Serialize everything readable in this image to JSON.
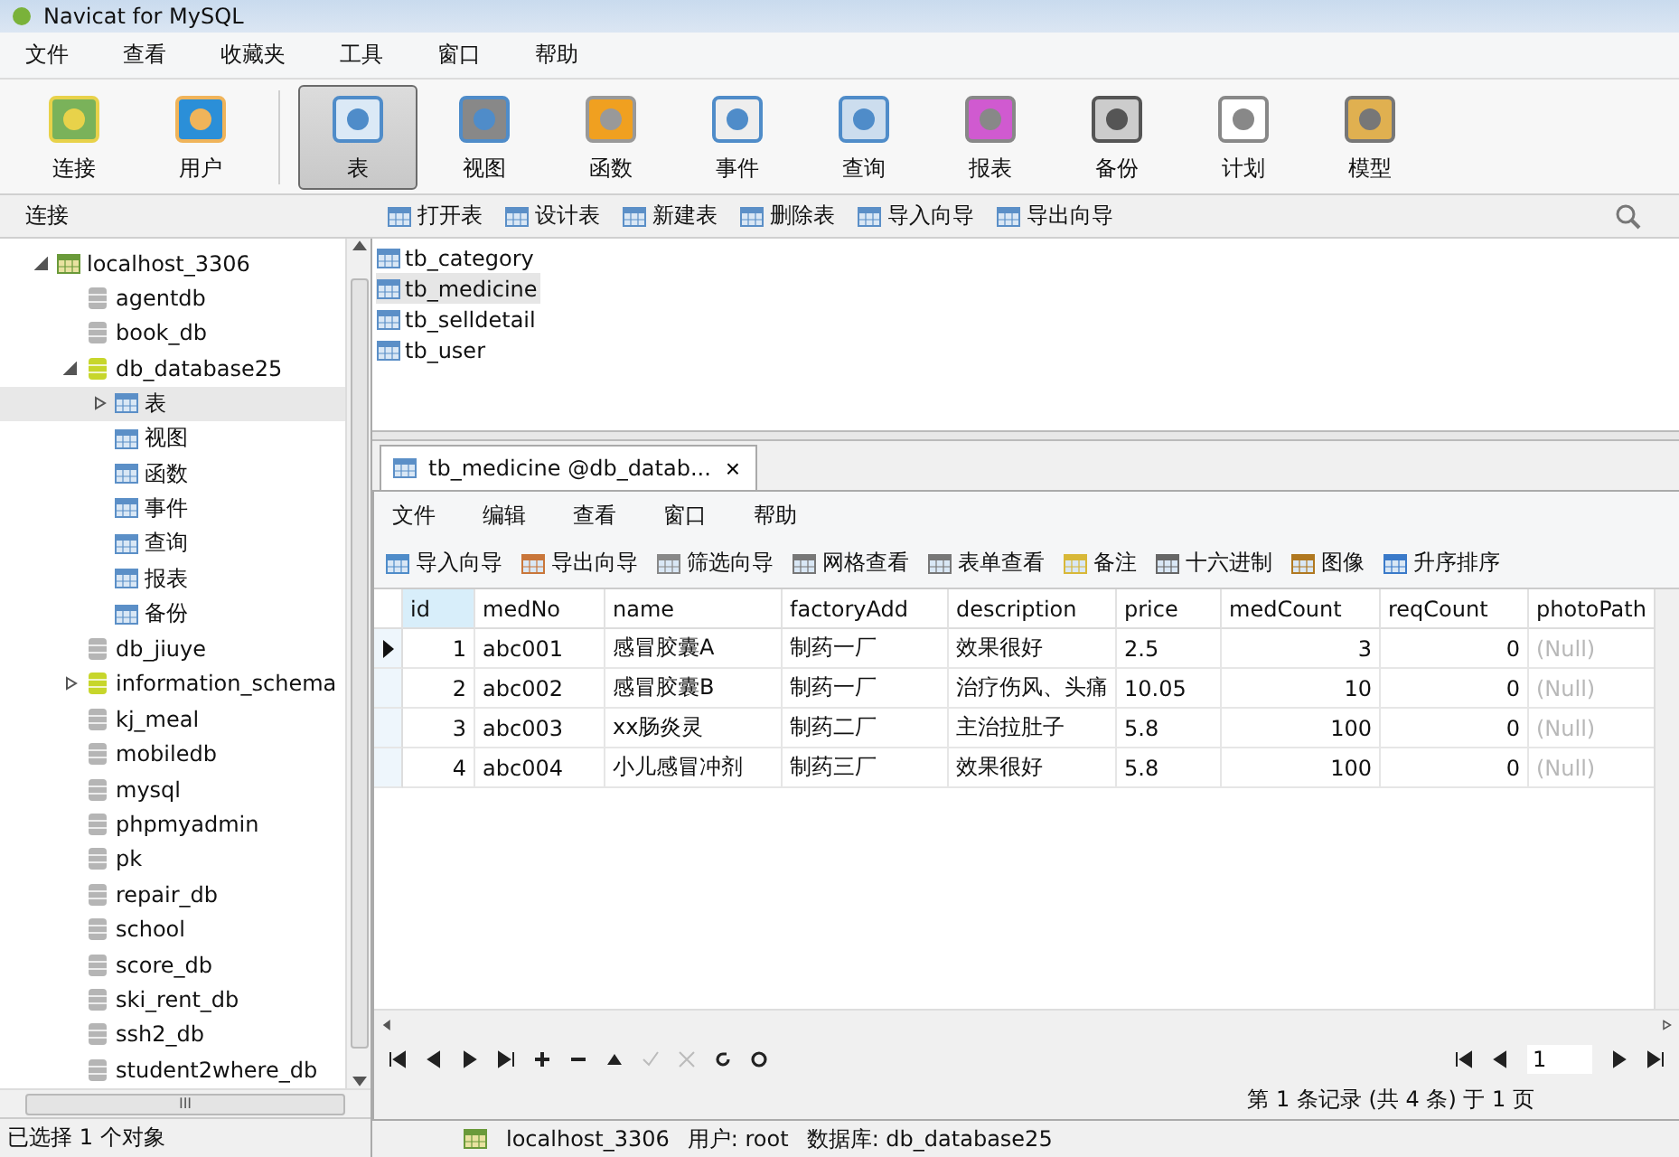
{
  "window": {
    "title": "Navicat for MySQL"
  },
  "menu": [
    "文件",
    "查看",
    "收藏夹",
    "工具",
    "窗口",
    "帮助"
  ],
  "toolbar": [
    {
      "label": "连接",
      "selected": false
    },
    {
      "label": "用户",
      "selected": false
    },
    {
      "label": "表",
      "selected": true
    },
    {
      "label": "视图",
      "selected": false
    },
    {
      "label": "函数",
      "selected": false
    },
    {
      "label": "事件",
      "selected": false
    },
    {
      "label": "查询",
      "selected": false
    },
    {
      "label": "报表",
      "selected": false
    },
    {
      "label": "备份",
      "selected": false
    },
    {
      "label": "计划",
      "selected": false
    },
    {
      "label": "模型",
      "selected": false
    }
  ],
  "sidebar": {
    "header": "连接",
    "tree": [
      {
        "label": "localhost_3306",
        "kind": "connection",
        "expanded": true,
        "selected": false,
        "children": [
          {
            "label": "agentdb",
            "kind": "database",
            "active": false,
            "selected": false
          },
          {
            "label": "book_db",
            "kind": "database",
            "active": false,
            "selected": false
          },
          {
            "label": "db_database25",
            "kind": "database",
            "active": true,
            "expanded": true,
            "selected": false,
            "children": [
              {
                "label": "表",
                "kind": "object",
                "expanded": false,
                "selected": true
              },
              {
                "label": "视图",
                "kind": "object",
                "selected": false
              },
              {
                "label": "函数",
                "kind": "object",
                "selected": false
              },
              {
                "label": "事件",
                "kind": "object",
                "selected": false
              },
              {
                "label": "查询",
                "kind": "object",
                "selected": false
              },
              {
                "label": "报表",
                "kind": "object",
                "selected": false
              },
              {
                "label": "备份",
                "kind": "object",
                "selected": false
              }
            ]
          },
          {
            "label": "db_jiuye",
            "kind": "database",
            "active": false,
            "selected": false
          },
          {
            "label": "information_schema",
            "kind": "database",
            "active": true,
            "expanded": false,
            "selected": false
          },
          {
            "label": "kj_meal",
            "kind": "database",
            "active": false,
            "selected": false
          },
          {
            "label": "mobiledb",
            "kind": "database",
            "active": false,
            "selected": false
          },
          {
            "label": "mysql",
            "kind": "database",
            "active": false,
            "selected": false
          },
          {
            "label": "phpmyadmin",
            "kind": "database",
            "active": false,
            "selected": false
          },
          {
            "label": "pk",
            "kind": "database",
            "active": false,
            "selected": false
          },
          {
            "label": "repair_db",
            "kind": "database",
            "active": false,
            "selected": false
          },
          {
            "label": "school",
            "kind": "database",
            "active": false,
            "selected": false
          },
          {
            "label": "score_db",
            "kind": "database",
            "active": false,
            "selected": false
          },
          {
            "label": "ski_rent_db",
            "kind": "database",
            "active": false,
            "selected": false
          },
          {
            "label": "ssh2_db",
            "kind": "database",
            "active": false,
            "selected": false
          },
          {
            "label": "student2where_db",
            "kind": "database",
            "active": false,
            "selected": false
          }
        ]
      }
    ],
    "scroll_grip": "III"
  },
  "object_actions": [
    "打开表",
    "设计表",
    "新建表",
    "删除表",
    "导入向导",
    "导出向导"
  ],
  "tables": [
    {
      "label": "tb_category",
      "selected": false
    },
    {
      "label": "tb_medicine",
      "selected": true
    },
    {
      "label": "tb_selldetail",
      "selected": false
    },
    {
      "label": "tb_user",
      "selected": false
    }
  ],
  "editor": {
    "tab": {
      "label": "tb_medicine @db_datab...",
      "close": "×"
    },
    "menu": [
      "文件",
      "编辑",
      "查看",
      "窗口",
      "帮助"
    ],
    "toolbar": [
      "导入向导",
      "导出向导",
      "筛选向导",
      "网格查看",
      "表单查看",
      "备注",
      "十六进制",
      "图像",
      "升序排序"
    ],
    "table": {
      "columns": [
        {
          "label": "id",
          "right_aligned": true,
          "muted": false
        },
        {
          "label": "medNo",
          "right_aligned": false,
          "muted": false
        },
        {
          "label": "name",
          "right_aligned": false,
          "muted": false
        },
        {
          "label": "factoryAdd",
          "right_aligned": false,
          "muted": false
        },
        {
          "label": "description",
          "right_aligned": false,
          "muted": false
        },
        {
          "label": "price",
          "right_aligned": false,
          "muted": false
        },
        {
          "label": "medCount",
          "right_aligned": true,
          "muted": false
        },
        {
          "label": "reqCount",
          "right_aligned": true,
          "muted": false
        },
        {
          "label": "photoPath",
          "right_aligned": false,
          "muted": true
        }
      ],
      "rows": [
        {
          "selected": true,
          "cells": [
            "1",
            "abc001",
            "感冒胶囊A",
            "制药一厂",
            "效果很好",
            "2.5",
            "3",
            "0",
            "(Null)"
          ]
        },
        {
          "selected": false,
          "cells": [
            "2",
            "abc002",
            "感冒胶囊B",
            "制药一厂",
            "治疗伤风、头痛",
            "10.05",
            "10",
            "0",
            "(Null)"
          ]
        },
        {
          "selected": false,
          "cells": [
            "3",
            "abc003",
            "xx肠炎灵",
            "制药二厂",
            "主治拉肚子",
            "5.8",
            "100",
            "0",
            "(Null)"
          ]
        },
        {
          "selected": false,
          "cells": [
            "4",
            "abc004",
            "小儿感冒冲剂",
            "制药三厂",
            "效果很好",
            "5.8",
            "100",
            "0",
            "(Null)"
          ]
        }
      ]
    },
    "page": "1",
    "record_status": "第 1 条记录 (共 4 条) 于 1 页"
  },
  "status_bar": {
    "selection": "已选择 1 个对象",
    "connection": "localhost_3306",
    "user": "用户: root",
    "database": "数据库: db_database25"
  }
}
